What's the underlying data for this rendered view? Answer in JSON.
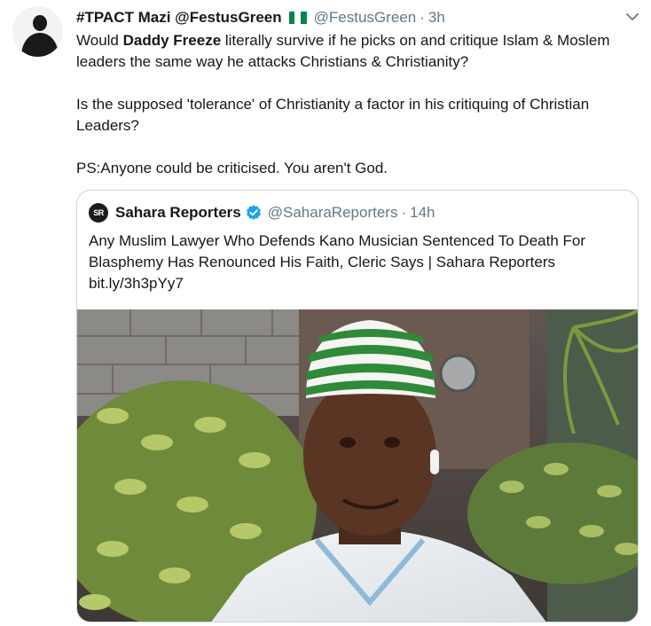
{
  "tweet": {
    "display_name": "#TPACT Mazi @FestusGreen",
    "handle": "@FestusGreen",
    "separator": "·",
    "time": "3h",
    "paragraph1": {
      "pre": "Would ",
      "bold": "Daddy Freeze",
      "post": " literally survive if he picks on and critique Islam & Moslem leaders the same way he attacks Christians & Christianity?"
    },
    "paragraph2": "Is the supposed 'tolerance' of Christianity a factor in his critiquing of Christian Leaders?",
    "paragraph3": "PS:Anyone could be criticised. You aren't God."
  },
  "quoted": {
    "logo_text": "SR",
    "name": "Sahara Reporters",
    "handle": "@SaharaReporters",
    "separator": "·",
    "time": "14h",
    "text": "Any Muslim Lawyer Who Defends Kano Musician Sentenced To Death For Blasphemy Has Renounced His Faith, Cleric Says | Sahara Reporters bit.ly/3h3pYy7"
  },
  "icons": {
    "flag": "nigeria-flag-icon",
    "verified": "verified-badge-icon",
    "caret": "chevron-down-icon"
  },
  "colors": {
    "flag_green": "#008751",
    "verified_blue": "#1da1f2",
    "secondary_text": "#657786",
    "border": "#ccd6dd"
  }
}
